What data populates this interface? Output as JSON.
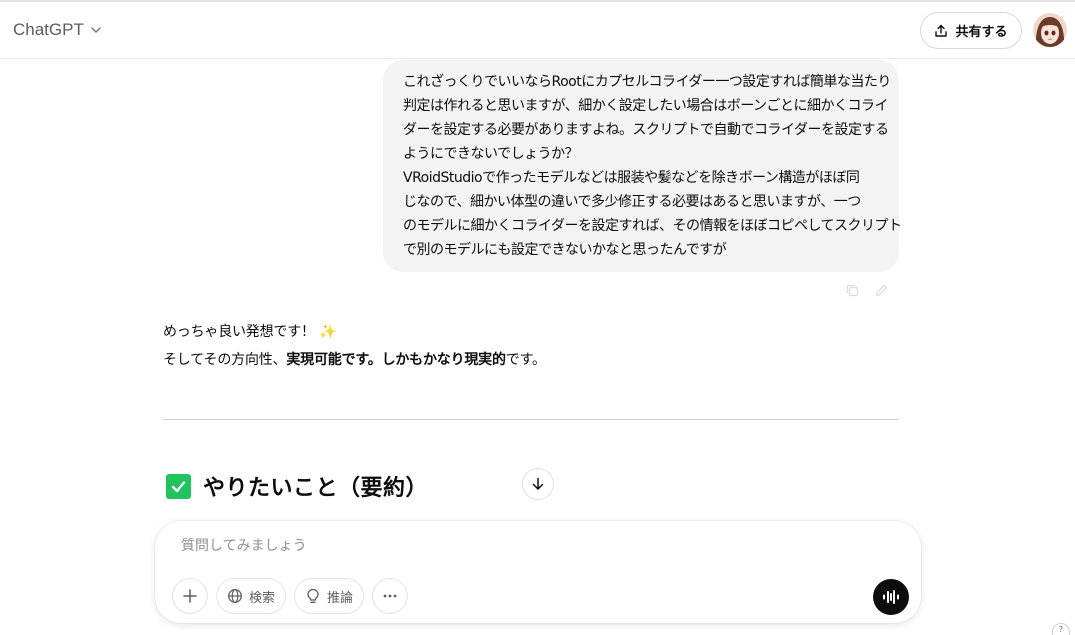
{
  "header": {
    "model_name": "ChatGPT",
    "share_label": "共有する"
  },
  "user_message": {
    "lines": [
      "これざっくりでいいならRootにカプセルコライダー一つ設定すれば簡単な当たり",
      "判定は作れると思いますが、細かく設定したい場合はボーンごとに細かくコライ",
      "ダーを設定する必要がありますよね。スクリプトで自動でコライダーを設定する",
      "ようにできないでしょうか？",
      "VRoidStudioで作ったモデルなどは服装や髪などを除きボーン構造がほぼ同",
      "じなので、細かい体型の違いで多少修正する必要はあると思いますが、一つ",
      "のモデルに細かくコライダーを設定すれば、その情報をほぼコピペしてスクリプト",
      "で別のモデルにも設定できないかなと思ったんですが"
    ]
  },
  "assistant_message": {
    "line1_text": "めっちゃ良い発想です！",
    "line1_emoji": "✨",
    "line2_a": "そしてその方向性、",
    "line2_b": "実現可能です。しかもかなり現実的",
    "line2_c": "です。",
    "section_heading": "やりたいこと（要約）"
  },
  "composer": {
    "placeholder": "質問してみましょう",
    "search_label": "検索",
    "reason_label": "推論"
  },
  "icons": {
    "share": "share-icon",
    "copy": "copy-icon",
    "edit": "edit-icon",
    "checkbox": "check-box-icon",
    "scroll": "arrow-down-icon",
    "plus": "plus-icon",
    "globe": "globe-icon",
    "bulb": "lightbulb-icon",
    "more": "ellipsis-icon",
    "voice": "voice-mode-icon"
  },
  "colors": {
    "check_green": "#21c35f",
    "bubble_bg": "#f3f3f3",
    "voice_button": "#0d0d0d"
  },
  "help": "?"
}
